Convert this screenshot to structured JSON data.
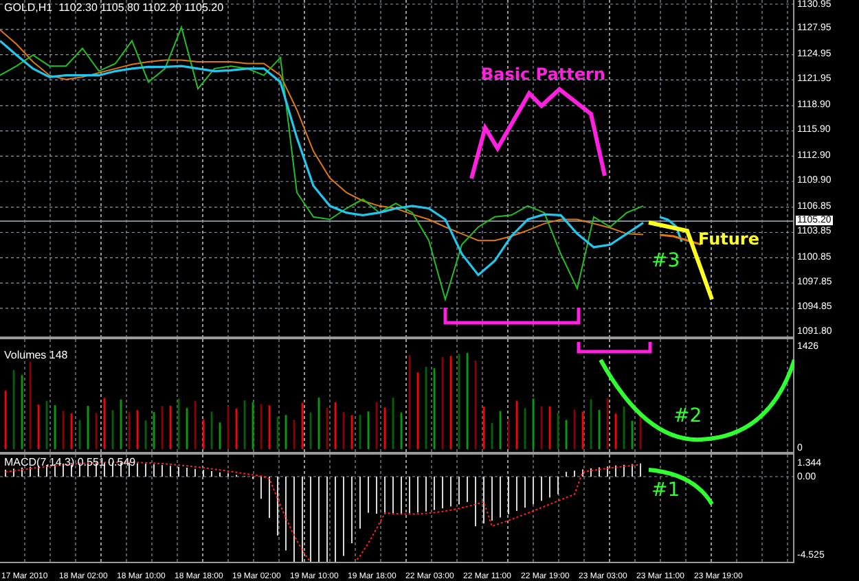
{
  "symbol_header": "GOLD,H1  1102.30 1105.80 1102.20 1105.20",
  "price_chart": {
    "chart_data": {
      "type": "line",
      "ylim": [
        1091.5,
        1131.44
      ],
      "grid": true,
      "ref_lines": [
        {
          "axis": "y",
          "value": 1105.2,
          "label": "1105.20",
          "color": "#7a8a9a"
        }
      ],
      "categories": [
        null,
        null,
        null,
        null,
        null,
        null,
        null,
        null,
        null,
        null,
        null,
        null,
        null,
        null,
        null,
        null,
        null,
        null,
        null,
        null,
        null,
        null,
        null,
        null,
        null,
        null,
        null,
        null,
        null,
        null,
        null,
        null,
        null,
        null,
        null,
        null,
        null,
        null,
        null,
        null
      ],
      "yticks": [
        {
          "value": 1130.95,
          "label": "1130.95"
        },
        {
          "value": 1127.95,
          "label": "1127.95"
        },
        {
          "value": 1124.95,
          "label": "1124.95"
        },
        {
          "value": 1121.95,
          "label": "1121.95"
        },
        {
          "value": 1118.9,
          "label": "1118.90"
        },
        {
          "value": 1115.9,
          "label": "1115.90"
        },
        {
          "value": 1112.9,
          "label": "1112.90"
        },
        {
          "value": 1109.9,
          "label": "1109.90"
        },
        {
          "value": 1106.85,
          "label": "1106.85"
        },
        {
          "value": 1103.85,
          "label": "1103.85"
        },
        {
          "value": 1100.85,
          "label": "1100.85"
        },
        {
          "value": 1097.85,
          "label": "1097.85"
        },
        {
          "value": 1094.85,
          "label": "1094.85"
        },
        {
          "value": 1091.8,
          "label": "1091.80"
        }
      ],
      "series": [
        {
          "color": "#e07a10",
          "values": [
            1127.9,
            1126.2,
            1124.1,
            1122.5,
            1122.0,
            1122.3,
            1122.8,
            1123.3,
            1123.8,
            1124.1,
            1124.3,
            1124.3,
            1124.1,
            1124.1,
            1124.1,
            1123.9,
            1123.9,
            1122.5,
            1118.4,
            1113.5,
            1110.3,
            1108.6,
            1107.6,
            1107.0,
            1106.7,
            1106.0,
            1105.4,
            1104.5,
            1103.7,
            1102.9,
            1102.9,
            1103.4,
            1104.1,
            1104.9,
            1105.4,
            1105.4,
            1104.9,
            1104.4,
            1103.7,
            1103.6
          ]
        },
        {
          "color": "#22c022",
          "values": [
            1122.5,
            1123.6,
            1124.9,
            1123.6,
            1123.6,
            1125.7,
            1123.0,
            1123.9,
            1126.6,
            1121.7,
            1123.3,
            1128.2,
            1120.9,
            1123.3,
            1123.6,
            1123.3,
            1122.5,
            1124.6,
            1108.6,
            1105.7,
            1105.4,
            1106.7,
            1107.8,
            1106.2,
            1107.3,
            1106.2,
            1102.9,
            1095.9,
            1102.4,
            1104.5,
            1105.7,
            1105.9,
            1107.0,
            1106.2,
            1101.3,
            1097.2,
            1105.7,
            1104.5,
            1106.2,
            1107.0
          ]
        },
        {
          "color": "#20c8f0",
          "values": [
            1126.6,
            1124.9,
            1123.3,
            1122.3,
            1122.5,
            1122.5,
            1122.5,
            1123.0,
            1123.3,
            1123.5,
            1123.5,
            1123.6,
            1123.3,
            1123.0,
            1123.1,
            1123.3,
            1123.3,
            1121.7,
            1115.1,
            1109.4,
            1107.0,
            1106.2,
            1105.9,
            1106.2,
            1106.7,
            1107.0,
            1106.7,
            1105.4,
            1101.3,
            1098.8,
            1100.5,
            1103.4,
            1105.4,
            1106.0,
            1105.9,
            1103.7,
            1102.1,
            1102.4,
            1103.7,
            1105.0
          ]
        }
      ]
    }
  },
  "volume_panel": {
    "label": "Volumes 148",
    "axis": [
      "1426",
      "0"
    ]
  },
  "macd_panel": {
    "label": "MACD(7,14,3) 0.551 0.549",
    "axis": [
      "1.344",
      "0.00",
      "-4.525"
    ]
  },
  "time_axis": [
    "17 Mar 2010",
    "18 Mar 02:00",
    "18 Mar 10:00",
    "18 Mar 18:00",
    "19 Mar 02:00",
    "19 Mar 10:00",
    "19 Mar 18:00",
    "22 Mar 03:00",
    "22 Mar 11:00",
    "22 Mar 19:00",
    "23 Mar 03:00",
    "23 Mar 11:00",
    "23 Mar 19:00"
  ],
  "annotations": {
    "pattern_label": "Basic Pattern",
    "future_label": "Future",
    "markers": [
      "#3",
      "#2",
      "#1"
    ]
  }
}
